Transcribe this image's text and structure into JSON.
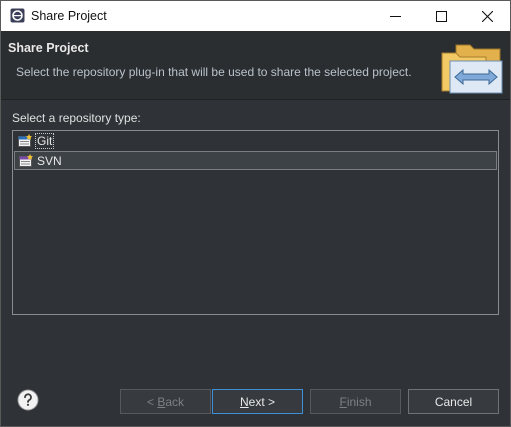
{
  "window": {
    "title": "Share Project",
    "controls": [
      "minimize",
      "maximize",
      "close"
    ]
  },
  "banner": {
    "title": "Share Project",
    "description": "Select the repository plug-in that will be used to share the selected project.",
    "graphic_icon": "folder-share-icon"
  },
  "body": {
    "prompt": "Select a repository type:",
    "repository_types": [
      {
        "label": "Git",
        "icon": "git-icon",
        "focused": true,
        "selected": false
      },
      {
        "label": "SVN",
        "icon": "svn-icon",
        "focused": false,
        "selected": true
      }
    ]
  },
  "footer": {
    "help_icon": "help-icon",
    "back": {
      "mnemonic_prefix": "< ",
      "mnemonic": "B",
      "rest": "ack",
      "enabled": false
    },
    "next": {
      "mnemonic": "N",
      "rest": "ext >",
      "enabled": true
    },
    "finish": {
      "mnemonic": "F",
      "rest": "inish",
      "enabled": false
    },
    "cancel": {
      "label": "Cancel",
      "enabled": true
    }
  },
  "colors": {
    "dialog_bg": "#2f3337",
    "banner_bg": "#2b2e31",
    "default_button_border": "#3d8fd6"
  }
}
